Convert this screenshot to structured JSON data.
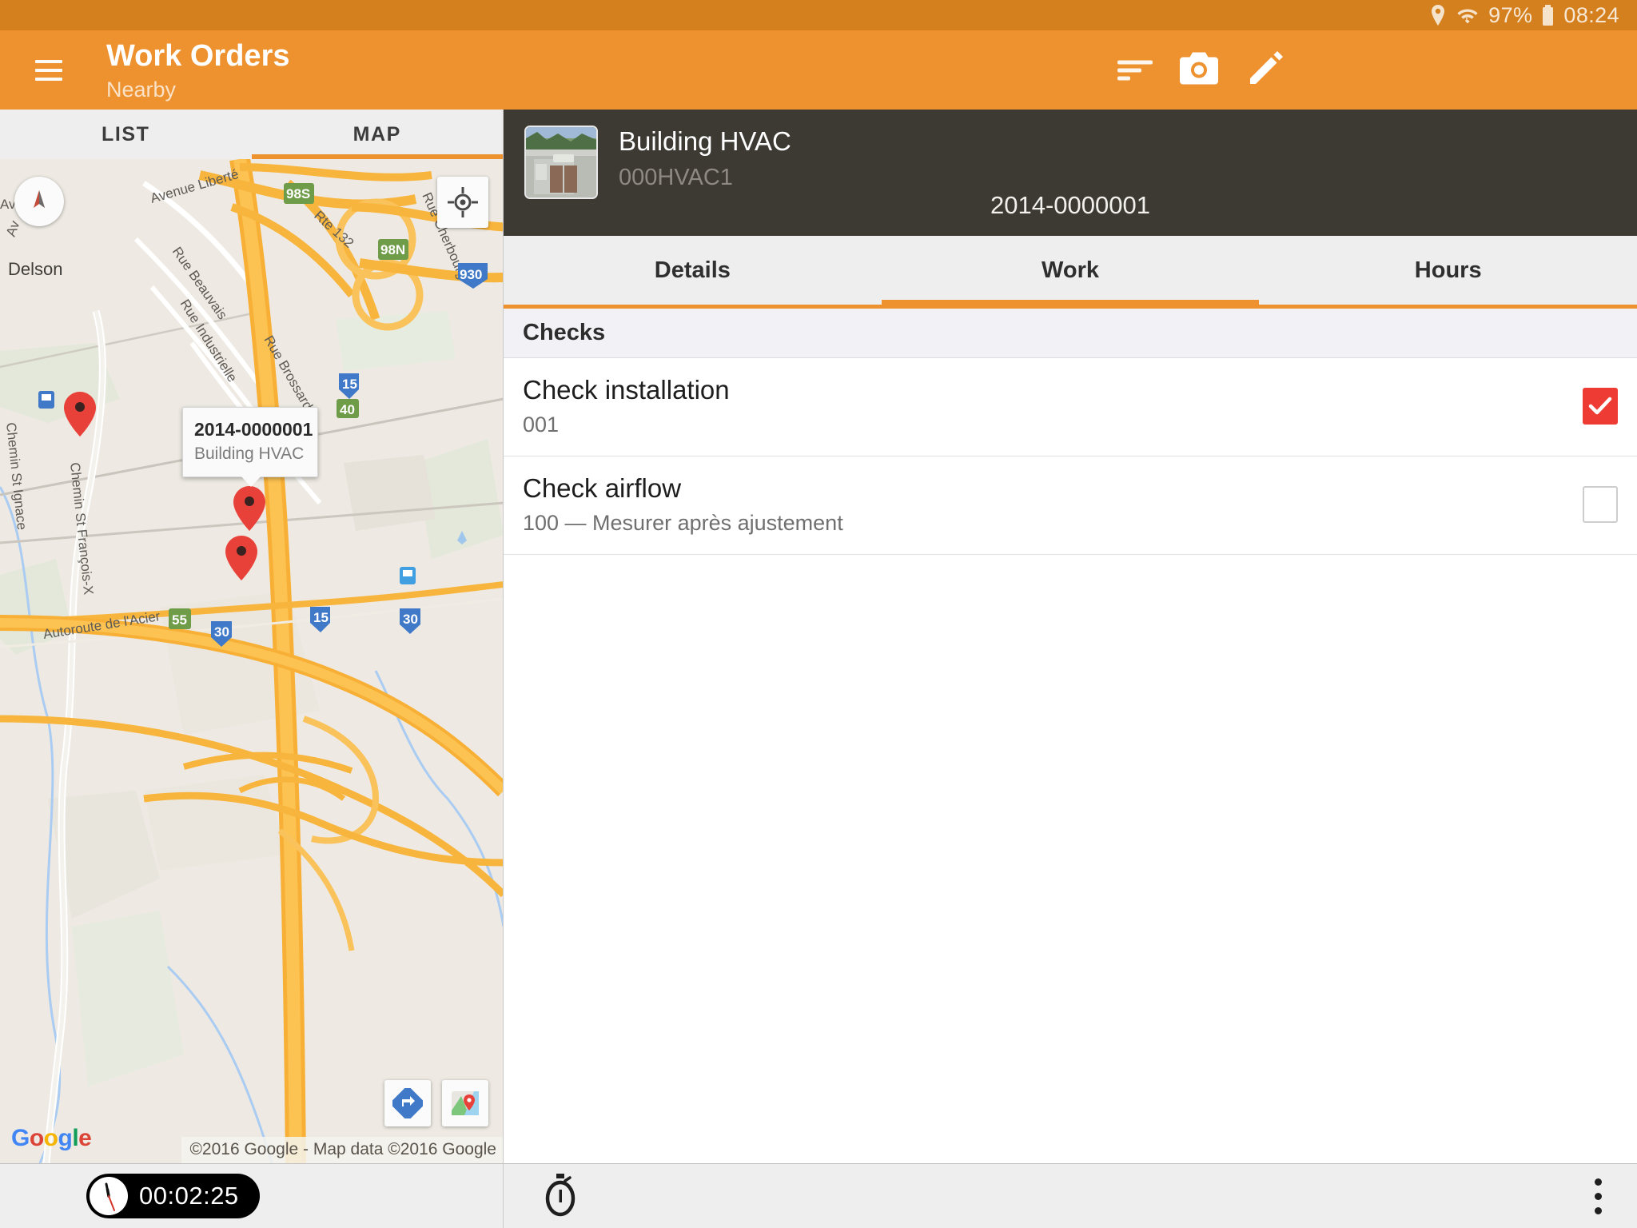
{
  "status_bar": {
    "location_icon": "location-pin-icon",
    "wifi_icon": "wifi-icon",
    "battery_percent": "97%",
    "battery_icon": "battery-icon",
    "time": "08:24"
  },
  "app_bar": {
    "menu_icon": "hamburger-menu-icon",
    "title": "Work Orders",
    "subtitle": "Nearby",
    "actions": [
      {
        "name": "sort-icon",
        "label": "Sort"
      },
      {
        "name": "camera-icon",
        "label": "Camera"
      },
      {
        "name": "edit-icon",
        "label": "Edit"
      }
    ],
    "accent_color": "#ed922f"
  },
  "left_pane": {
    "tabs": [
      {
        "label": "LIST",
        "active": false
      },
      {
        "label": "MAP",
        "active": true
      }
    ],
    "map": {
      "compass_icon": "compass-icon",
      "locate_icon": "my-location-icon",
      "info_window": {
        "title": "2014-0000001",
        "subtitle": "Building HVAC"
      },
      "street_labels": [
        "Avenue Liberté",
        "Rue Beauvais",
        "Rue Industrielle",
        "Rue Brossard",
        "Rue Cherbourg",
        "Rte 132",
        "Chemin St Ignace",
        "Chemin St François-Xavier",
        "Autoroute de l'Acier",
        "Avenue",
        "Av",
        "Delson"
      ],
      "route_shields": [
        {
          "label": "98S",
          "color": "green"
        },
        {
          "label": "98N",
          "color": "green"
        },
        {
          "label": "930",
          "color": "blue"
        },
        {
          "label": "15",
          "color": "blue"
        },
        {
          "label": "40",
          "color": "green"
        },
        {
          "label": "55",
          "color": "green"
        },
        {
          "label": "30",
          "color": "blue"
        },
        {
          "label": "15",
          "color": "blue"
        },
        {
          "label": "30",
          "color": "blue"
        }
      ],
      "logo_letters": [
        "G",
        "o",
        "o",
        "g",
        "l",
        "e"
      ],
      "attribution": "©2016 Google - Map data ©2016 Google",
      "directions_icon": "directions-icon",
      "open-maps-icon": "open-in-google-maps-icon"
    }
  },
  "right_pane": {
    "asset_name": "Building HVAC",
    "asset_code": "000HVAC1",
    "asset_thumb_icon": "rooftop-hvac-photo",
    "work_order_number": "2014-0000001",
    "tabs": [
      {
        "label": "Details",
        "active": false
      },
      {
        "label": "Work",
        "active": true
      },
      {
        "label": "Hours",
        "active": false
      }
    ],
    "section_header": "Checks",
    "checks": [
      {
        "title": "Check installation",
        "subtitle": "001",
        "checked": true
      },
      {
        "title": "Check airflow",
        "subtitle": "100 — Mesurer après ajustement",
        "checked": false
      }
    ]
  },
  "bottom_bar": {
    "timer_icon": "analog-clock-icon",
    "timer_value": "00:02:25",
    "stopwatch_icon": "stopwatch-icon",
    "overflow_icon": "overflow-menu-icon"
  }
}
